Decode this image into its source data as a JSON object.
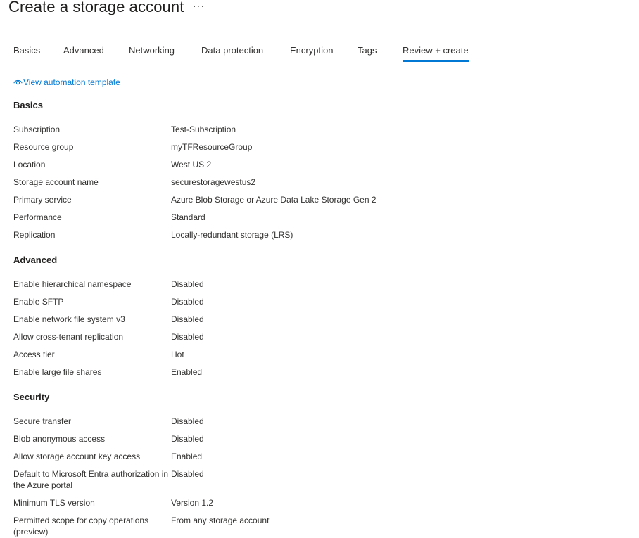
{
  "header": {
    "title": "Create a storage account",
    "more_label": "···"
  },
  "tabs": [
    {
      "label": "Basics",
      "active": false
    },
    {
      "label": "Advanced",
      "active": false
    },
    {
      "label": "Networking",
      "active": false
    },
    {
      "label": "Data protection",
      "active": false
    },
    {
      "label": "Encryption",
      "active": false
    },
    {
      "label": "Tags",
      "active": false
    },
    {
      "label": "Review + create",
      "active": true
    }
  ],
  "automation_link": {
    "label": "View automation template",
    "icon": "eye-icon"
  },
  "sections": [
    {
      "heading": "Basics",
      "rows": [
        {
          "label": "Subscription",
          "value": "Test-Subscription"
        },
        {
          "label": "Resource group",
          "value": "myTFResourceGroup"
        },
        {
          "label": "Location",
          "value": "West US 2"
        },
        {
          "label": "Storage account name",
          "value": "securestoragewestus2"
        },
        {
          "label": "Primary service",
          "value": "Azure Blob Storage or Azure Data Lake Storage Gen 2"
        },
        {
          "label": "Performance",
          "value": "Standard"
        },
        {
          "label": "Replication",
          "value": "Locally-redundant storage (LRS)"
        }
      ]
    },
    {
      "heading": "Advanced",
      "rows": [
        {
          "label": "Enable hierarchical namespace",
          "value": "Disabled"
        },
        {
          "label": "Enable SFTP",
          "value": "Disabled"
        },
        {
          "label": "Enable network file system v3",
          "value": "Disabled"
        },
        {
          "label": "Allow cross-tenant replication",
          "value": "Disabled"
        },
        {
          "label": "Access tier",
          "value": "Hot"
        },
        {
          "label": "Enable large file shares",
          "value": "Enabled"
        }
      ]
    },
    {
      "heading": "Security",
      "rows": [
        {
          "label": "Secure transfer",
          "value": "Disabled"
        },
        {
          "label": "Blob anonymous access",
          "value": "Disabled"
        },
        {
          "label": "Allow storage account key access",
          "value": "Enabled"
        },
        {
          "label": "Default to Microsoft Entra authorization in the Azure portal",
          "value": "Disabled"
        },
        {
          "label": "Minimum TLS version",
          "value": "Version 1.2"
        },
        {
          "label": "Permitted scope for copy operations (preview)",
          "value": "From any storage account"
        }
      ]
    }
  ],
  "colors": {
    "accent": "#0078d4",
    "text": "#323130",
    "heading": "#201f1e"
  }
}
